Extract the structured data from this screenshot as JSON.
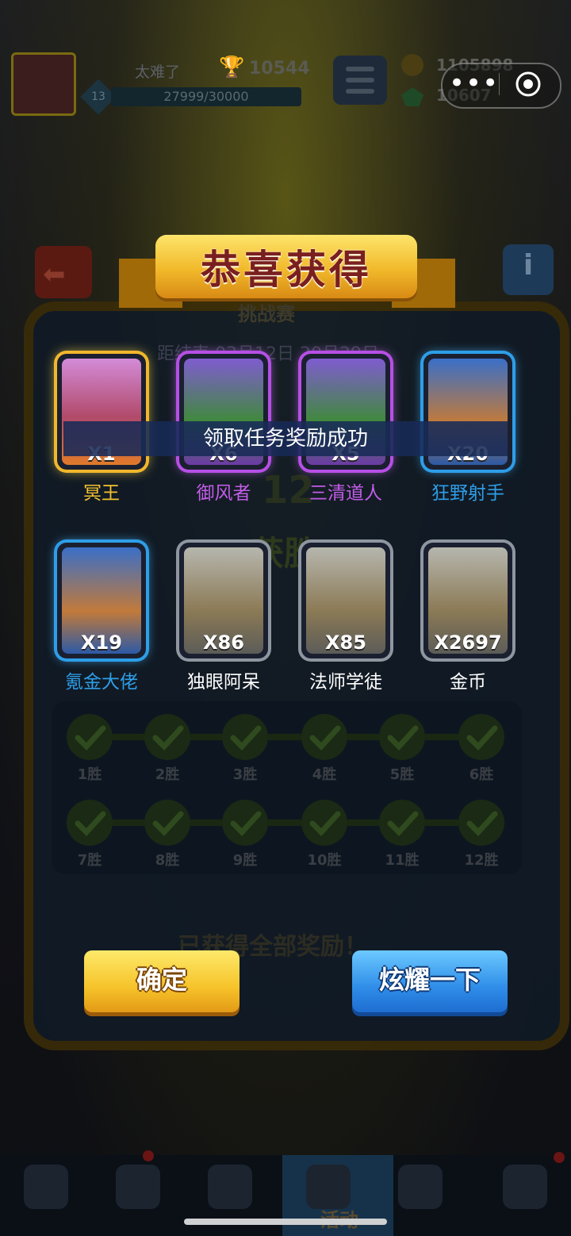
{
  "player": {
    "name": "太难了",
    "trophies": "10544",
    "level": "13",
    "xp": "27999/30000"
  },
  "currency": {
    "coins": "1105898",
    "gems": "10607"
  },
  "panel": {
    "title": "挑战赛",
    "date": "距结束 03月12日 20月29日",
    "wins_big": "12",
    "wins_word": "获胜",
    "all_claimed": "已获得全部奖励！"
  },
  "win_track": {
    "row1": [
      "1胜",
      "2胜",
      "3胜",
      "4胜",
      "5胜",
      "6胜"
    ],
    "row2": [
      "7胜",
      "8胜",
      "9胜",
      "10胜",
      "11胜",
      "12胜"
    ]
  },
  "modal": {
    "title": "恭喜获得",
    "toast": "领取任务奖励成功",
    "rewards": [
      {
        "qty": "X1",
        "name": "冥王",
        "rarity": "legendary",
        "name_color": "#f4c230"
      },
      {
        "qty": "X6",
        "name": "御风者",
        "rarity": "epic",
        "name_color": "#c25ce8"
      },
      {
        "qty": "X5",
        "name": "三清道人",
        "rarity": "epic",
        "name_color": "#c25ce8"
      },
      {
        "qty": "X20",
        "name": "狂野射手",
        "rarity": "rare",
        "name_color": "#2e9ee8"
      },
      {
        "qty": "X19",
        "name": "氪金大佬",
        "rarity": "rare",
        "name_color": "#2e9ee8"
      },
      {
        "qty": "X86",
        "name": "独眼阿呆",
        "rarity": "common",
        "name_color": "#ffffff"
      },
      {
        "qty": "X85",
        "name": "法师学徒",
        "rarity": "common",
        "name_color": "#ffffff"
      },
      {
        "qty": "X2697",
        "name": "金币",
        "rarity": "common",
        "name_color": "#ffffff"
      }
    ],
    "ok_label": "确定",
    "share_label": "炫耀一下"
  },
  "nav": {
    "active_label": "活动",
    "items": [
      "chest-icon",
      "helmet-icon",
      "swords-icon",
      "activity-icon",
      "cards-icon",
      "compass-icon"
    ]
  },
  "capsule": {
    "more_icon": "more-dots-icon",
    "close_icon": "target-close-icon"
  }
}
